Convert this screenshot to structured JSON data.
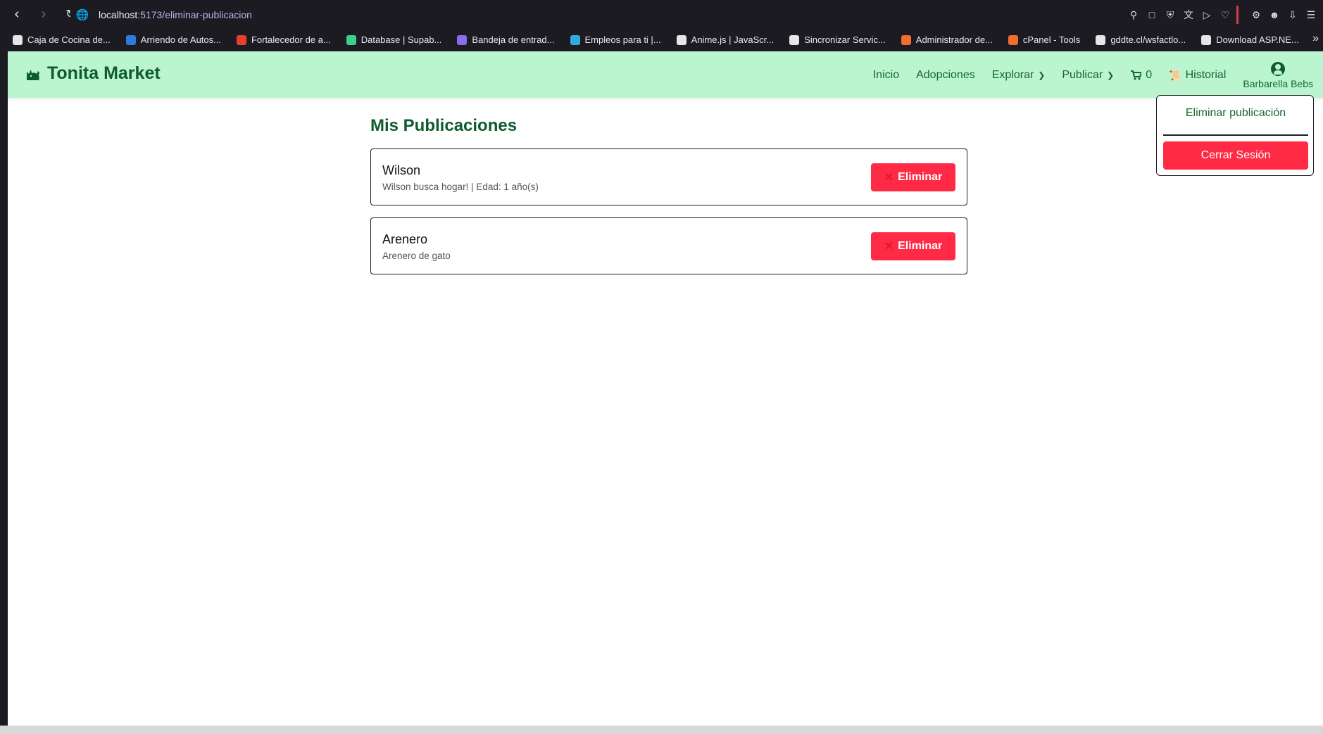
{
  "browser": {
    "url_host": "localhost",
    "url_path": ":5173/eliminar-publicacion",
    "bookmarks": [
      {
        "label": "Caja de Cocina de...",
        "color": "#e6e6e6"
      },
      {
        "label": "Arriendo de Autos...",
        "color": "#2b7be0"
      },
      {
        "label": "Fortalecedor de a...",
        "color": "#e8402f"
      },
      {
        "label": "Database | Supab...",
        "color": "#3ecf8e"
      },
      {
        "label": "Bandeja de entrad...",
        "color": "#8b6cf0"
      },
      {
        "label": "Empleos para ti |...",
        "color": "#33aadd"
      },
      {
        "label": "Anime.js | JavaScr...",
        "color": "#e6e6e6"
      },
      {
        "label": "Sincronizar Servic...",
        "color": "#e6e6e6"
      },
      {
        "label": "Administrador de...",
        "color": "#f36d2c"
      },
      {
        "label": "cPanel - Tools",
        "color": "#f36d2c"
      },
      {
        "label": "gddte.cl/wsfactlo...",
        "color": "#e6e6e6"
      },
      {
        "label": "Download ASP.NE...",
        "color": "#e6e6e6"
      }
    ]
  },
  "navbar": {
    "brand": "Tonita Market",
    "links": {
      "inicio": "Inicio",
      "adopciones": "Adopciones",
      "explorar": "Explorar",
      "publicar": "Publicar",
      "cart_count": "0",
      "historial": "Historial"
    },
    "user_name": "Barbarella Bebs"
  },
  "main": {
    "title": "Mis Publicaciones",
    "publications": [
      {
        "name": "Wilson",
        "description": "Wilson busca hogar! | Edad: 1 año(s)",
        "button": "Eliminar"
      },
      {
        "name": "Arenero",
        "description": "Arenero de gato",
        "button": "Eliminar"
      }
    ]
  },
  "dropdown": {
    "item": "Eliminar publicación",
    "logout": "Cerrar Sesión"
  },
  "colors": {
    "navbar_bg": "#bbf5cf",
    "brand_green": "#0f5b2d",
    "danger": "#ff2a45"
  }
}
